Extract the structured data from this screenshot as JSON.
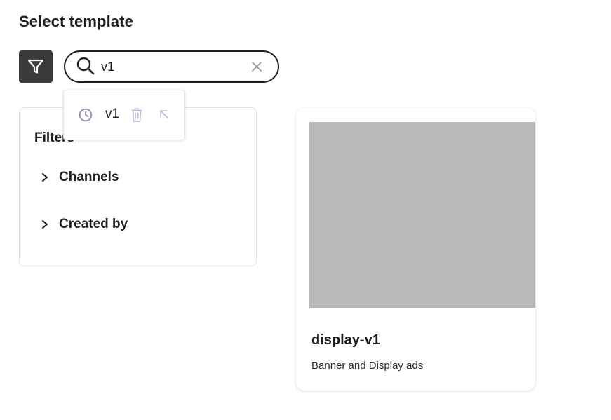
{
  "header": {
    "title": "Select template"
  },
  "search": {
    "value": "v1"
  },
  "suggestions": {
    "items": [
      {
        "label": "v1"
      }
    ]
  },
  "filters": {
    "heading": "Filters",
    "items": [
      {
        "label": "Channels"
      },
      {
        "label": "Created by"
      }
    ]
  },
  "results": {
    "cards": [
      {
        "name": "display-v1",
        "description": "Banner and Display ads"
      }
    ]
  },
  "icons": {
    "filter": "filter-icon",
    "search": "search-icon",
    "clear": "close-icon",
    "recent": "clock-icon",
    "delete": "trash-icon",
    "fill": "arrow-up-left-icon",
    "expand": "chevron-right-icon"
  },
  "colors": {
    "filter_button_bg": "#3a3a3a",
    "thumbnail_placeholder": "#b9b9b9",
    "suggestion_icon": "#8a8fb5"
  }
}
